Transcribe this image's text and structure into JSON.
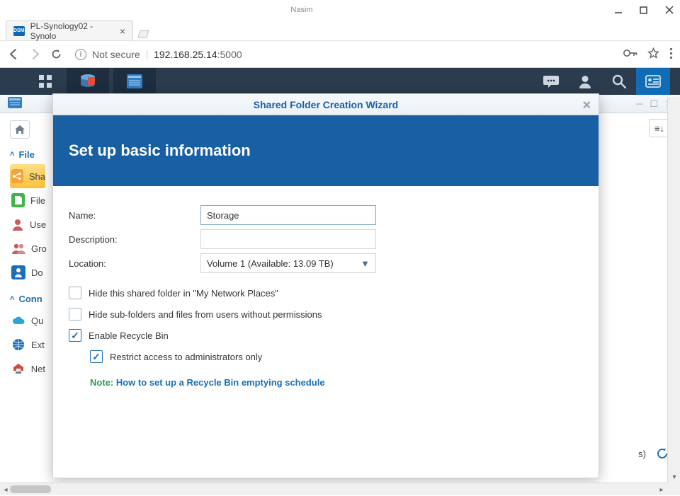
{
  "window": {
    "owner": "Nasim"
  },
  "browser": {
    "tab_title": "PL-Synology02 - Synolo",
    "tab_favicon_text": "DSM",
    "not_secure_label": "Not secure",
    "url_host": "192.168.25.14",
    "url_port": ":5000"
  },
  "sidebar": {
    "sections": [
      {
        "label": "File"
      },
      {
        "label": "Conn"
      }
    ],
    "items": [
      {
        "label": "Sha",
        "icon_bg": "#f7a13b"
      },
      {
        "label": "File",
        "icon_bg": "#3fb54b"
      },
      {
        "label": "Use",
        "icon_bg": "#c95c5c"
      },
      {
        "label": "Gro",
        "icon_bg": "#c95c5c"
      },
      {
        "label": "Do",
        "icon_bg": "#1b6fb6"
      },
      {
        "label": "Qu",
        "icon_bg": "#2aa7d8"
      },
      {
        "label": "Ext",
        "icon_bg": "#1b6fb6"
      },
      {
        "label": "Net",
        "icon_bg": "#d74b3a"
      }
    ]
  },
  "bottom": {
    "suffix": "s)"
  },
  "wizard": {
    "title": "Shared Folder Creation Wizard",
    "header": "Set up basic information",
    "fields": {
      "name_label": "Name:",
      "name_value": "Storage",
      "description_label": "Description:",
      "description_value": "",
      "location_label": "Location:",
      "location_value": "Volume 1 (Available: 13.09 TB)"
    },
    "checkboxes": {
      "hide_folder": "Hide this shared folder in \"My Network Places\"",
      "hide_subfolders": "Hide sub-folders and files from users without permissions",
      "enable_recycle": "Enable Recycle Bin",
      "restrict_admin": "Restrict access to administrators only"
    },
    "note_label": "Note:",
    "note_link": "How to set up a Recycle Bin emptying schedule"
  }
}
